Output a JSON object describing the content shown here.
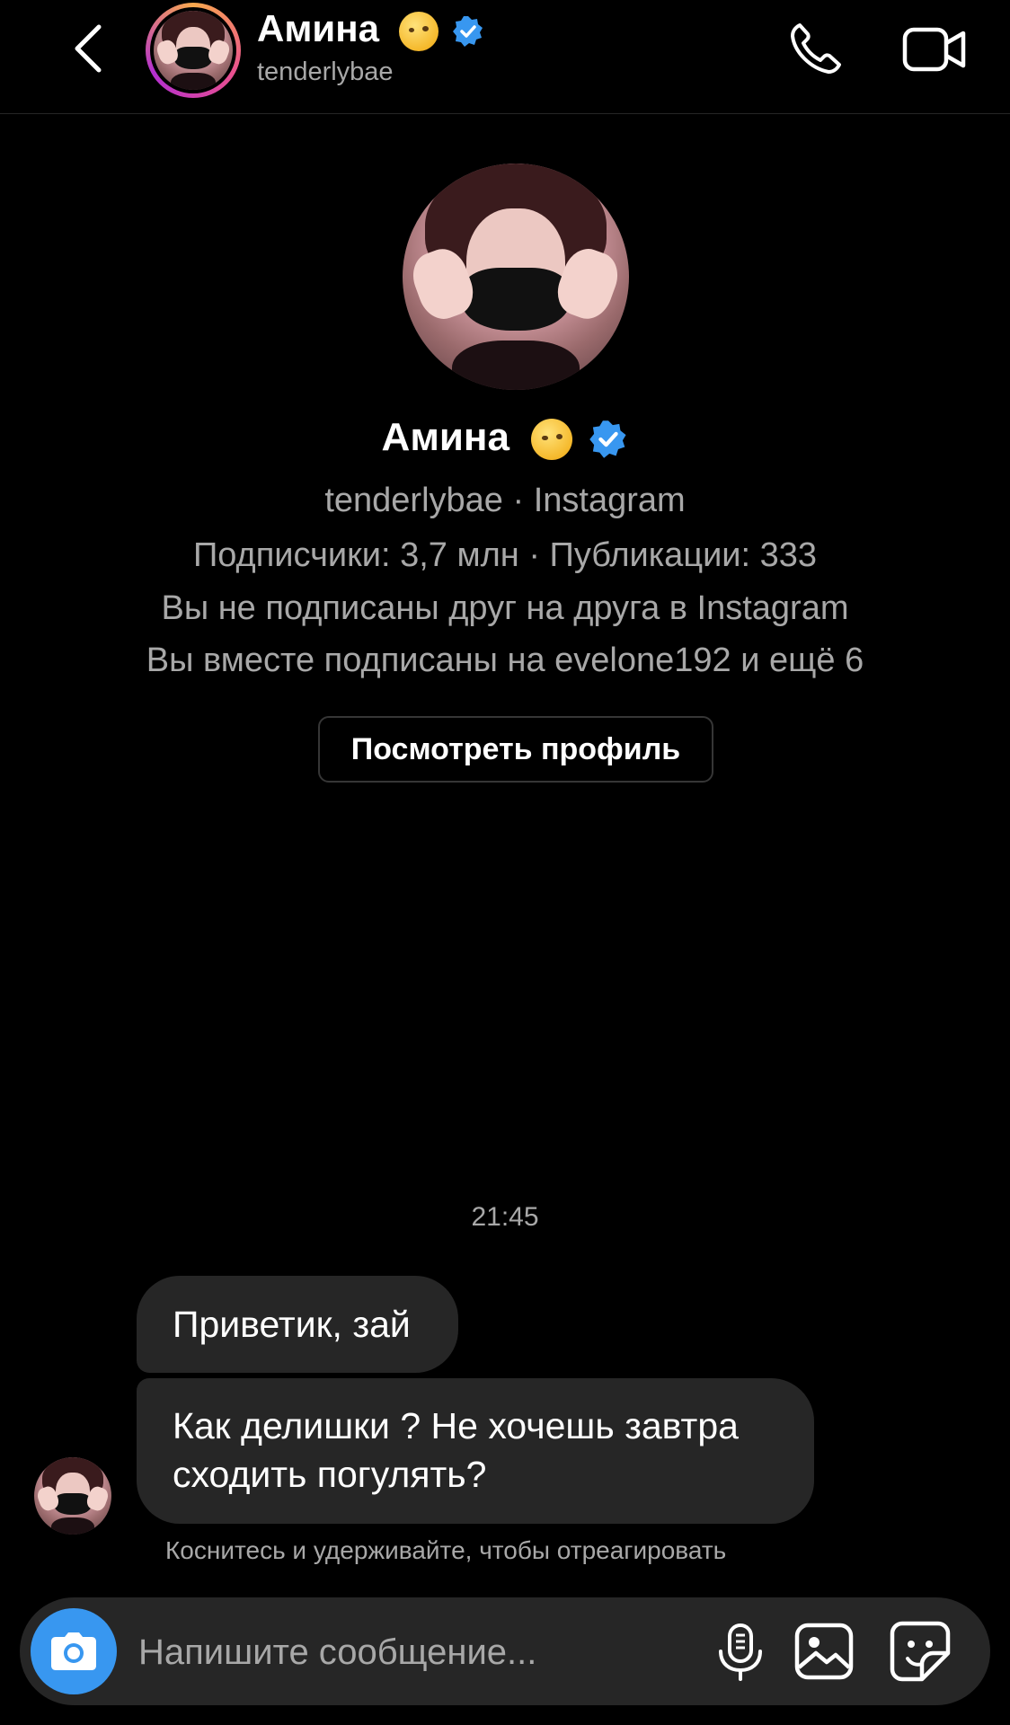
{
  "header": {
    "name": "Амина",
    "username": "tenderlybae",
    "back_icon": "chevron-left-icon",
    "call_icon": "phone-icon",
    "video_icon": "video-camera-icon"
  },
  "profile": {
    "name": "Амина",
    "subtitle": "tenderlybae · Instagram",
    "stats": "Подписчики: 3,7 млн · Публикации: 333",
    "follow_status": "Вы не подписаны друг на друга в Instagram",
    "mutual": "Вы вместе подписаны на evelone192 и ещё 6",
    "view_profile_label": "Посмотреть профиль"
  },
  "conversation": {
    "timestamp": "21:45",
    "messages": [
      {
        "text": "Приветик, зай",
        "sender": "them"
      },
      {
        "text": "Как делишки ? Не хочешь завтра сходить погулять?",
        "sender": "them"
      }
    ],
    "reaction_hint": "Коснитесь и удерживайте, чтобы отреагировать"
  },
  "composer": {
    "placeholder": "Напишите сообщение...",
    "camera_icon": "camera-icon",
    "mic_icon": "microphone-icon",
    "gallery_icon": "image-icon",
    "sticker_icon": "sticker-icon"
  },
  "colors": {
    "background": "#000000",
    "bubble": "#262626",
    "secondary_text": "#a8a8a8",
    "accent": "#3897f0",
    "verified": "#3897f0"
  }
}
